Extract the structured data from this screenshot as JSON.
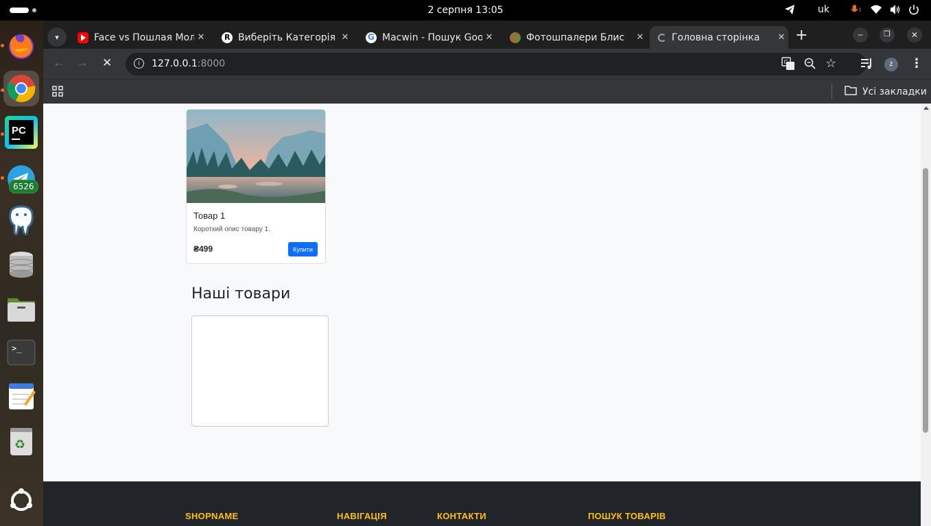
{
  "system": {
    "clock": "2 серпня  13:05",
    "keyboard_layout": "uk"
  },
  "dock": {
    "telegram_badge": "6526"
  },
  "browser": {
    "tabs": [
      {
        "label": "Face vs Пошлая Мол",
        "favicon": "youtube-icon",
        "color": "#ff0000"
      },
      {
        "label": "Виберіть Категорія",
        "favicon": "site-icon",
        "color": "#ffffff"
      },
      {
        "label": "Macwin - Пошук Goo",
        "favicon": "google-icon",
        "color": "#4285f4"
      },
      {
        "label": "Фотошпалери Блис",
        "favicon": "site-icon",
        "color": "#c8553d"
      },
      {
        "label": "Головна сторінка",
        "favicon": "loading-icon",
        "color": "#9aa0a6"
      }
    ],
    "url_host": "127.0.0.1",
    "url_port": ":8000",
    "profile_initial": "z",
    "bookmarks_label": "Усі закладки"
  },
  "page": {
    "product": {
      "title": "Товар 1",
      "description": "Короткий опис товару 1.",
      "price": "₴499",
      "buy_label": "Купити"
    },
    "section_title": "Наші товари",
    "footer": {
      "col1": "SHOPNAME",
      "col2": "НАВІГАЦІЯ",
      "col3": "КОНТАКТИ",
      "col4": "ПОШУК ТОВАРІВ"
    }
  },
  "colors": {
    "primary": "#0d6efd",
    "footer_accent": "#ffc107",
    "footer_bg": "#212529"
  }
}
